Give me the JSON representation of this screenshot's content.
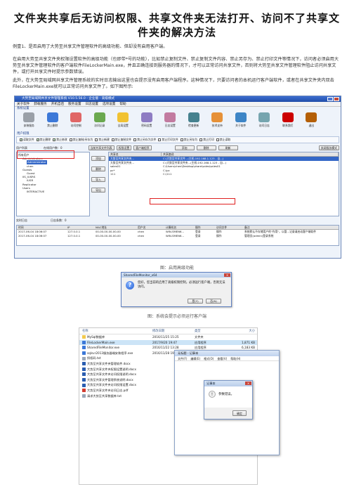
{
  "doc": {
    "title": "文件夹共享后无访问权限、共享文件夹无法打开、访问不了共享文件夹的解决方法",
    "para1": "例壹1、是否启用了大势至共享文件管理软件的高级功能、但却没有启用客户端。",
    "para2": "在启用大势至共享文件夹权限设置软件的高级功能（也即带*号的功能），比如禁止复制文件、禁止复制文件内容、禁止另存为、禁止打印文件等情况下，访问者必须启用大势至共享文件管理软件的客户端软件FileLockerMain.exe，并且正确连接到服务器的情况下，才可以正常访问共享文件，否则将大势至共享文件管理软件阻止访问共享文件，或打开共享文件时提示参数错误。",
    "para3": "此外，在大势至局域网共享文件管理系统的实时日志输出这里也会提示没有启用客户端程序。这种情况下，只要访问者的本机运行客户端软件，或者在共享文件夹内双击FileLockerMain.exe就可以正常访问共享文件了。如下图所示:",
    "caption1": "图：启用高级功能",
    "caption2": "图：系统会提示必须运行客户端"
  },
  "app": {
    "title": "大势至局域网共享文件管理系统 V10.5.56.0 - 企业版 - 高级模式",
    "menu": [
      "关于软件",
      "卸载服务",
      "开机自启",
      "服务设置",
      "日志设置",
      "选项设置",
      "帮助"
    ],
    "group_system": "系统设置",
    "tools": [
      {
        "label": "安装服务",
        "color": "#9aa0a8"
      },
      {
        "label": "禁止删除",
        "color": "#3c78d8"
      },
      {
        "label": "访问控制",
        "color": "#e06666"
      },
      {
        "label": "访问记录",
        "color": "#6aa84f"
      },
      {
        "label": "全局设置",
        "color": "#f1c232"
      },
      {
        "label": "密码设置",
        "color": "#8e7cc3"
      },
      {
        "label": "日志设置",
        "color": "#c27ba0"
      },
      {
        "label": "检查更新",
        "color": "#45818e"
      },
      {
        "label": "技术支持",
        "color": "#e69138"
      },
      {
        "label": "关于软件",
        "color": "#3d85c6"
      },
      {
        "label": "访问日志",
        "color": "#76a5af"
      },
      {
        "label": "联系我们",
        "color": "#cc0000"
      },
      {
        "label": "退出",
        "color": "#b45f06"
      }
    ],
    "group_user": "用户权限",
    "checks": [
      {
        "label": "读取文件",
        "checked": true
      },
      {
        "label": "禁止删除",
        "checked": true
      },
      {
        "label": "禁止修改",
        "checked": true
      },
      {
        "label": "禁止复制/另存为",
        "checked": false
      },
      {
        "label": "禁止新建",
        "checked": false
      },
      {
        "label": "禁止复制文件",
        "checked": false
      },
      {
        "label": "禁止另存为文件",
        "checked": false
      },
      {
        "label": "禁止打印文件",
        "checked": false
      },
      {
        "label": "禁止另存为",
        "checked": false
      },
      {
        "label": "禁止打印",
        "checked": false
      },
      {
        "label": "禁止读取",
        "checked": false
      }
    ],
    "bar": {
      "user_list": "用户列表",
      "online_users": "在线用户数：0",
      "btn_current": "当前共享文件列表",
      "btn_perm": "权限设置",
      "btn_client": "客户端程序",
      "btn_add": "添加",
      "btn_del": "删除",
      "btn_refresh": "刷新",
      "btn_close": "关闭服务模式"
    },
    "tree": [
      "所有用户",
      "Administrators",
      "Administrator",
      "chen",
      "Guests",
      "Guest",
      "IIS_IUSRS",
      "IUSR",
      "Replicator",
      "Users",
      "INTERACTIVE"
    ],
    "side_buttons": [
      "添加",
      "删除",
      "导入",
      "导出"
    ],
    "share_head": [
      "共享名",
      "共享路径"
    ],
    "shares": [
      [
        "大势至共享文件夹...",
        "C:\\大势至共享文件...(主机:192.168.1.123 - 自...)"
      ],
      [
        "大势至共享文件夹...",
        "C:\\大势至共享文件夹...(主机:192.168.1.123 - 自...)"
      ],
      [
        "sales01",
        "C:\\Users\\chen\\Desktop\\share\\sales\\sales01"
      ],
      [
        "pc*",
        "C:\\pc"
      ],
      [
        "111",
        "C:\\111"
      ]
    ],
    "log_label": "实时日志",
    "log_count": "日志条数：0",
    "log_head": [
      "时间",
      "IP",
      "MAC地址",
      "用户名",
      "计算机名",
      "操作",
      "访问文件",
      "备注"
    ],
    "logs": [
      [
        "2017-06-04 18:06:07",
        "127.0.0.1",
        "00-00-00-00-00-00",
        "chen",
        "WIN-SMEN6...",
        "登录",
        "操作",
        "系统默认不存储用户的\"作用\"，以管...记录请启动客户端软件"
      ],
      [
        "2017-06-04 18:06:07",
        "127.0.0.1",
        "00-00-00-00-00-00",
        "chen",
        "WIN-SMEN6...",
        "登录",
        "操作",
        "管理员(admin)登录系统"
      ]
    ]
  },
  "dialog1": {
    "title": "SharedFileMonitor_x64",
    "message": "您好，您当前的启用了高级权限控制，必须运行客户端，否则无法访问。",
    "yes": "是(Y)",
    "no": "否(N)"
  },
  "explorer": {
    "head": [
      "名称",
      "修改日期",
      "类型",
      "大小"
    ],
    "rows": [
      {
        "icon": "folder",
        "name": "MySql数据库",
        "date": "2016/11/25 15:25",
        "type": "文件夹",
        "size": ""
      },
      {
        "icon": "exe",
        "name": "FileLockerMain.exe",
        "date": "2017/9/20 19:47",
        "type": "应用程序",
        "size": "1,871 KB"
      },
      {
        "icon": "exe",
        "name": "SharedFileMonitor.exe",
        "date": "2016/11/22 13:28",
        "type": "应用程序",
        "size": "6,183 KB"
      },
      {
        "icon": "exe",
        "name": "sqlsvr2013服务器端安装程序.exe",
        "date": "2016/11/28 19:27",
        "type": "应用程序",
        "size": "19,352 KB"
      },
      {
        "icon": "gen",
        "name": "授权码.txt",
        "date": "",
        "type": "",
        "size": ""
      },
      {
        "icon": "doc",
        "name": "大势至共享文件夹管理软件.docx",
        "date": "",
        "type": "",
        "size": ""
      },
      {
        "icon": "doc",
        "name": "大势至共享文件夹权限设置说明.docx",
        "date": "",
        "type": "",
        "size": ""
      },
      {
        "icon": "doc",
        "name": "大势至共享文件夹访问权限说明.docx",
        "date": "",
        "type": "",
        "size": ""
      },
      {
        "icon": "doc",
        "name": "大势至共享文件管理系统说明.docx",
        "date": "",
        "type": "",
        "size": ""
      },
      {
        "icon": "doc",
        "name": "大势至共享文件夹访问权限设置.docx",
        "date": "",
        "type": "",
        "size": ""
      },
      {
        "icon": "pdf",
        "name": "大势至共享文件夹访问日志.pdf",
        "date": "",
        "type": "",
        "size": ""
      },
      {
        "icon": "gen",
        "name": "请求大势至共享数据库.txt",
        "date": "",
        "type": "",
        "size": ""
      }
    ]
  },
  "notepad": {
    "title": "无标题 - 记事本",
    "menu": [
      "文件(F)",
      "编辑(E)",
      "格式(O)",
      "查看(V)",
      "帮助(H)"
    ],
    "dialog_title": "记事本",
    "message": "参数错误。",
    "ok": "确定"
  }
}
